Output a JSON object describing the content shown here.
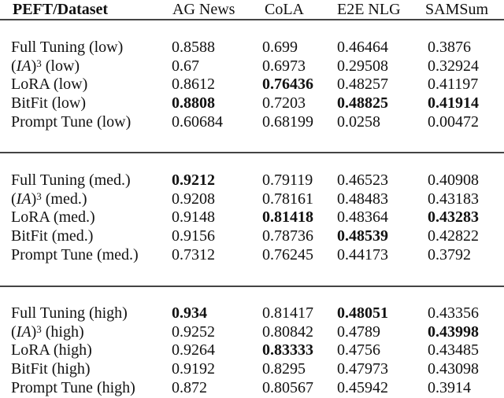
{
  "table": {
    "headers": [
      "PEFT/Dataset",
      "AG News",
      "CoLA",
      "E2E NLG",
      "SAMSum"
    ],
    "groups": [
      {
        "level": "low",
        "rows": [
          {
            "method": "Full Tuning",
            "label_suffix": "(low)",
            "values": [
              "0.8588",
              "0.699",
              "0.46464",
              "0.3876"
            ],
            "bold": [
              false,
              false,
              false,
              false
            ]
          },
          {
            "method": "(IA)3",
            "label_suffix": "(low)",
            "values": [
              "0.67",
              "0.6973",
              "0.29508",
              "0.32924"
            ],
            "bold": [
              false,
              false,
              false,
              false
            ]
          },
          {
            "method": "LoRA",
            "label_suffix": "(low)",
            "values": [
              "0.8612",
              "0.76436",
              "0.48257",
              "0.41197"
            ],
            "bold": [
              false,
              true,
              false,
              false
            ]
          },
          {
            "method": "BitFit",
            "label_suffix": "(low)",
            "values": [
              "0.8808",
              "0.7203",
              "0.48825",
              "0.41914"
            ],
            "bold": [
              true,
              false,
              true,
              true
            ]
          },
          {
            "method": "Prompt Tune",
            "label_suffix": "(low)",
            "values": [
              "0.60684",
              "0.68199",
              "0.0258",
              "0.00472"
            ],
            "bold": [
              false,
              false,
              false,
              false
            ]
          }
        ]
      },
      {
        "level": "med.",
        "rows": [
          {
            "method": "Full Tuning",
            "label_suffix": "(med.)",
            "values": [
              "0.9212",
              "0.79119",
              "0.46523",
              "0.40908"
            ],
            "bold": [
              true,
              false,
              false,
              false
            ]
          },
          {
            "method": "(IA)3",
            "label_suffix": "(med.)",
            "values": [
              "0.9208",
              "0.78161",
              "0.48483",
              "0.43183"
            ],
            "bold": [
              false,
              false,
              false,
              false
            ]
          },
          {
            "method": "LoRA",
            "label_suffix": "(med.)",
            "values": [
              "0.9148",
              "0.81418",
              "0.48364",
              "0.43283"
            ],
            "bold": [
              false,
              true,
              false,
              true
            ]
          },
          {
            "method": "BitFit",
            "label_suffix": "(med.)",
            "values": [
              "0.9156",
              "0.78736",
              "0.48539",
              "0.42822"
            ],
            "bold": [
              false,
              false,
              true,
              false
            ]
          },
          {
            "method": "Prompt Tune",
            "label_suffix": "(med.)",
            "values": [
              "0.7312",
              "0.76245",
              "0.44173",
              "0.3792"
            ],
            "bold": [
              false,
              false,
              false,
              false
            ]
          }
        ]
      },
      {
        "level": "high",
        "rows": [
          {
            "method": "Full Tuning",
            "label_suffix": "(high)",
            "values": [
              "0.934",
              "0.81417",
              "0.48051",
              "0.43356"
            ],
            "bold": [
              true,
              false,
              true,
              false
            ]
          },
          {
            "method": "(IA)3",
            "label_suffix": "(high)",
            "values": [
              "0.9252",
              "0.80842",
              "0.4789",
              "0.43998"
            ],
            "bold": [
              false,
              false,
              false,
              true
            ]
          },
          {
            "method": "LoRA",
            "label_suffix": "(high)",
            "values": [
              "0.9264",
              "0.83333",
              "0.4756",
              "0.43485"
            ],
            "bold": [
              false,
              true,
              false,
              false
            ]
          },
          {
            "method": "BitFit",
            "label_suffix": "(high)",
            "values": [
              "0.9192",
              "0.8295",
              "0.47973",
              "0.43098"
            ],
            "bold": [
              false,
              false,
              false,
              false
            ]
          },
          {
            "method": "Prompt Tune",
            "label_suffix": "(high)",
            "values": [
              "0.872",
              "0.80567",
              "0.45942",
              "0.3914"
            ],
            "bold": [
              false,
              false,
              false,
              false
            ]
          }
        ]
      }
    ]
  }
}
